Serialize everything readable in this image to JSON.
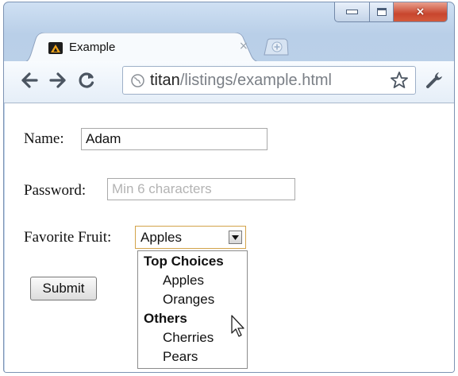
{
  "window": {
    "controls": {
      "minimize": "minimize-icon",
      "maximize": "maximize-icon",
      "close": "×"
    }
  },
  "tab": {
    "title": "Example",
    "close": "×",
    "favicon": "A"
  },
  "toolbar": {
    "url_host": "titan",
    "url_path": "/listings/example.html"
  },
  "form": {
    "name_label": "Name:",
    "name_value": "Adam",
    "password_label": "Password:",
    "password_placeholder": "Min 6 characters",
    "fruit_label": "Favorite Fruit:",
    "fruit_selected": "Apples",
    "submit_label": "Submit"
  },
  "dropdown": {
    "groups": [
      {
        "label": "Top Choices",
        "options": [
          "Apples",
          "Oranges"
        ]
      },
      {
        "label": "Others",
        "options": [
          "Cherries",
          "Pears"
        ]
      }
    ]
  },
  "colors": {
    "select_focus_border": "#d3a34a",
    "close_button": "#c8462e"
  }
}
